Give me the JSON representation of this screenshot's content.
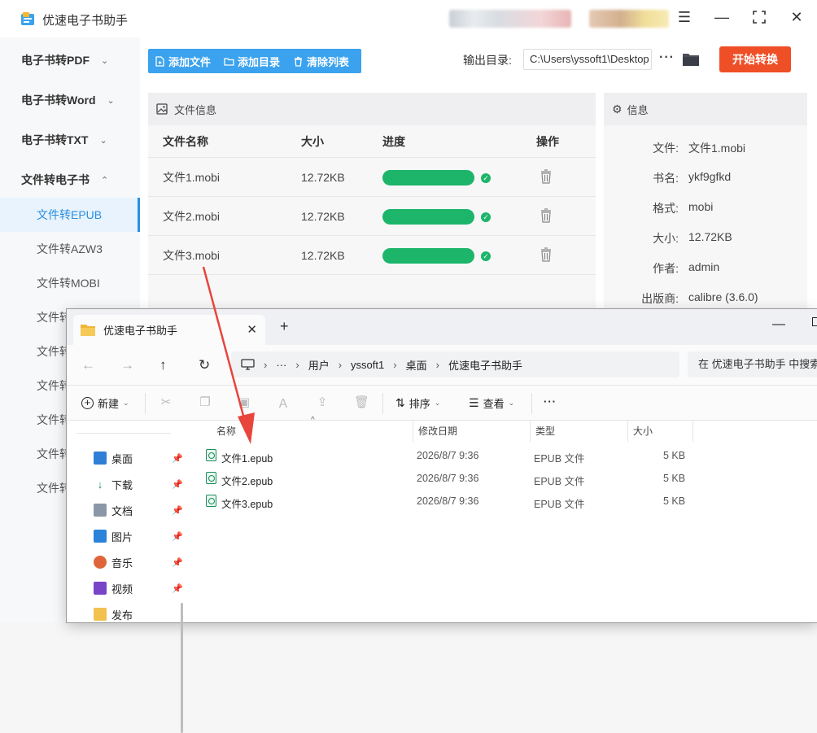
{
  "app": {
    "title": "优速电子书助手",
    "colors": {
      "accent": "#3aa2ee",
      "start": "#ef4f26",
      "progress": "#1cb56a"
    }
  },
  "sidebar": {
    "groups": [
      {
        "label": "电子书转PDF",
        "chevron": "⌄"
      },
      {
        "label": "电子书转Word",
        "chevron": "⌄"
      },
      {
        "label": "电子书转TXT",
        "chevron": "⌄"
      },
      {
        "label": "文件转电子书",
        "chevron": "⌃"
      }
    ],
    "items": [
      "文件转EPUB",
      "文件转AZW3",
      "文件转MOBI",
      "文件转",
      "文件转",
      "文件转",
      "文件转",
      "文件转",
      "文件转"
    ],
    "active_item": "文件转EPUB"
  },
  "toolbar": {
    "add_file": "添加文件",
    "add_dir": "添加目录",
    "clear_list": "清除列表",
    "output_label": "输出目录:",
    "output_path": "C:\\Users\\yssoft1\\Desktop",
    "more": "···",
    "start": "开始转换"
  },
  "file_panel": {
    "title": "文件信息",
    "columns": [
      "文件名称",
      "大小",
      "进度",
      "操作"
    ],
    "rows": [
      {
        "name": "文件1.mobi",
        "size": "12.72KB",
        "progress": 1.0
      },
      {
        "name": "文件2.mobi",
        "size": "12.72KB",
        "progress": 1.0
      },
      {
        "name": "文件3.mobi",
        "size": "12.72KB",
        "progress": 1.0
      }
    ]
  },
  "info_panel": {
    "title": "信息",
    "fields": [
      {
        "k": "文件:",
        "v": "文件1.mobi"
      },
      {
        "k": "书名:",
        "v": "ykf9gfkd"
      },
      {
        "k": "格式:",
        "v": "mobi"
      },
      {
        "k": "大小:",
        "v": "12.72KB"
      },
      {
        "k": "作者:",
        "v": "admin"
      },
      {
        "k": "出版商:",
        "v": "calibre (3.6.0)"
      }
    ]
  },
  "explorer": {
    "tab_title": "优速电子书助手",
    "new_tab": "+",
    "breadcrumb": [
      "用户",
      "yssoft1",
      "桌面",
      "优速电子书助手"
    ],
    "breadcrumb_more": "···",
    "search_placeholder": "在 优速电子书助手 中搜索",
    "commands": {
      "new": "新建",
      "sort": "排序",
      "view": "查看",
      "more": "···"
    },
    "quick_access": [
      {
        "label": "桌面",
        "icon": "desktop-icon",
        "color": "#2f7fd6"
      },
      {
        "label": "下载",
        "icon": "download-icon",
        "color": "#1a8a6a"
      },
      {
        "label": "文档",
        "icon": "document-icon",
        "color": "#6b7a8c"
      },
      {
        "label": "图片",
        "icon": "picture-icon",
        "color": "#2b82d9"
      },
      {
        "label": "音乐",
        "icon": "music-icon",
        "color": "#e0643a"
      },
      {
        "label": "视频",
        "icon": "video-icon",
        "color": "#7a44c8"
      },
      {
        "label": "发布",
        "icon": "folder-icon",
        "color": "#f2c14e"
      }
    ],
    "columns": [
      "名称",
      "修改日期",
      "类型",
      "大小"
    ],
    "files": [
      {
        "name": "文件1.epub",
        "date": "2026/8/7 9:36",
        "type": "EPUB 文件",
        "size": "5 KB"
      },
      {
        "name": "文件2.epub",
        "date": "2026/8/7 9:36",
        "type": "EPUB 文件",
        "size": "5 KB"
      },
      {
        "name": "文件3.epub",
        "date": "2026/8/7 9:36",
        "type": "EPUB 文件",
        "size": "5 KB"
      }
    ]
  }
}
